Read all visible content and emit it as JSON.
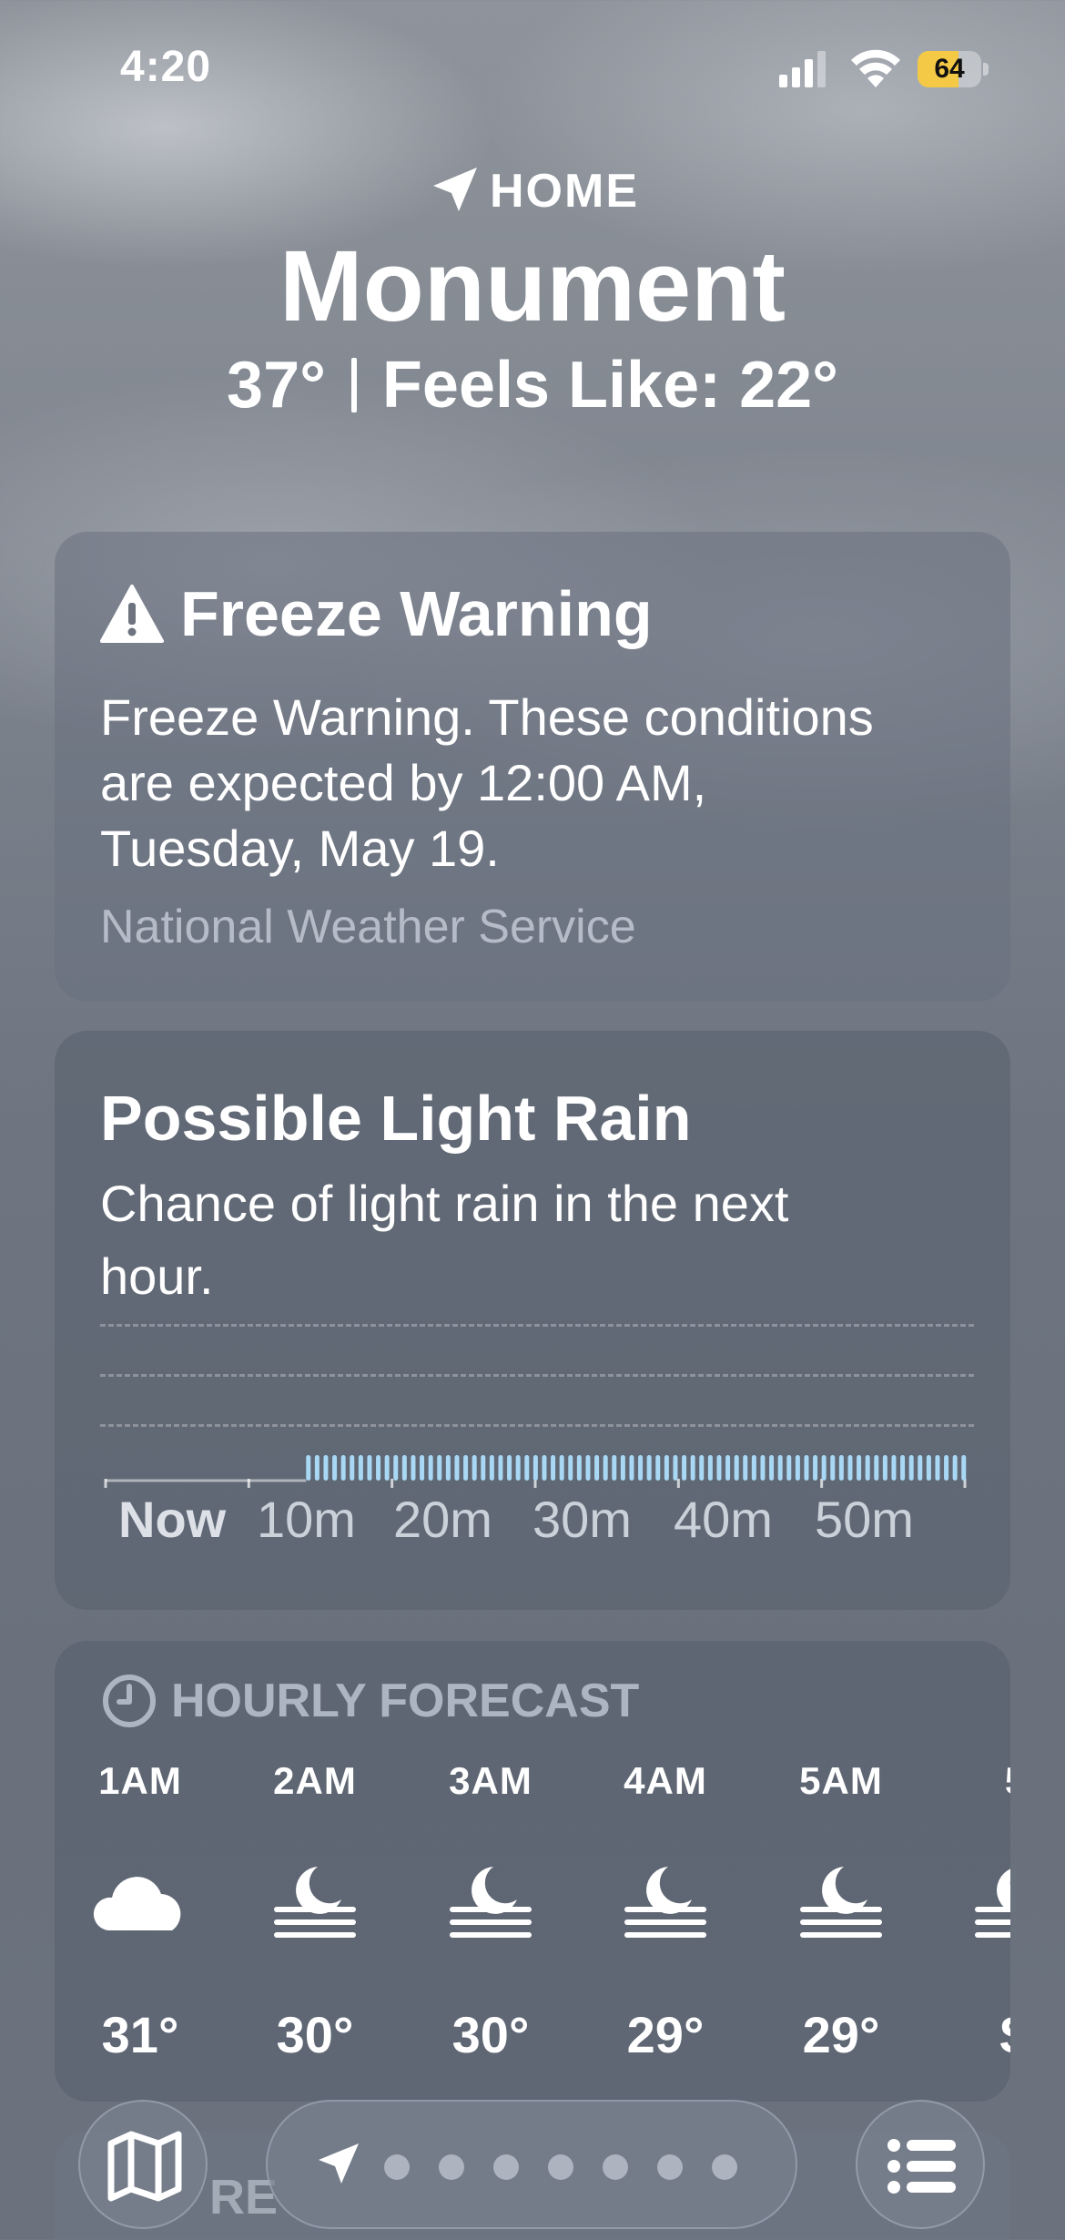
{
  "status_bar": {
    "time": "4:20",
    "battery_percent": "64",
    "battery_level": 0.64,
    "signal_bars": 3,
    "icons": [
      "signal-icon",
      "wifi-icon",
      "battery-icon"
    ]
  },
  "header": {
    "location_icon": "location-arrow-icon",
    "home_label": "HOME",
    "city": "Monument",
    "temperature": "37°",
    "feels_like": "Feels Like: 22°"
  },
  "alert": {
    "icon": "warning-triangle-icon",
    "title": "Freeze Warning",
    "text": "Freeze Warning. These conditions are expected by 12:00 AM, Tuesday, May 19.",
    "source": "National Weather Service"
  },
  "precip": {
    "title": "Possible Light Rain",
    "text": "Chance of light rain in the next hour.",
    "chart_data": {
      "type": "bar",
      "x_labels": [
        "Now",
        "10m",
        "20m",
        "30m",
        "40m",
        "50m"
      ],
      "minutes": 60,
      "rain_start_minute": 14,
      "intensity": "light",
      "bar_color": "#a9d8f5"
    }
  },
  "hourly": {
    "icon": "clock-icon",
    "title": "HOURLY FORECAST",
    "hours": [
      {
        "label": "1AM",
        "icon": "cloud-icon",
        "temp": "31°"
      },
      {
        "label": "2AM",
        "icon": "moon-fog-icon",
        "temp": "30°"
      },
      {
        "label": "3AM",
        "icon": "moon-fog-icon",
        "temp": "30°"
      },
      {
        "label": "4AM",
        "icon": "moon-fog-icon",
        "temp": "29°"
      },
      {
        "label": "5AM",
        "icon": "moon-fog-icon",
        "temp": "29°"
      },
      {
        "label": "5",
        "icon": "moon-fog-icon",
        "temp": "S"
      }
    ]
  },
  "next_card_peek": "RE",
  "bottom_bar": {
    "map_icon": "map-icon",
    "list_icon": "list-icon",
    "location_icon": "location-arrow-icon",
    "page_dots": 7
  }
}
